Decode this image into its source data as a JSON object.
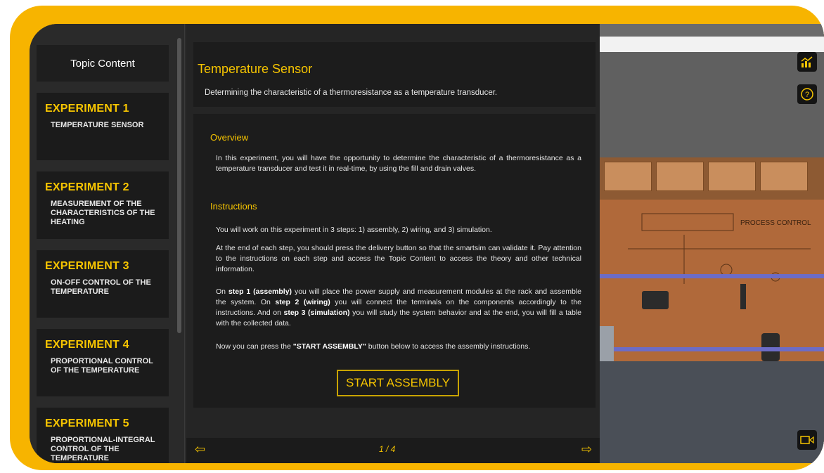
{
  "sidebar": {
    "topic_button": "Topic Content",
    "experiments": [
      {
        "title": "EXPERIMENT 1",
        "subtitle": "TEMPERATURE SENSOR"
      },
      {
        "title": "EXPERIMENT 2",
        "subtitle": "MEASUREMENT OF THE CHARACTERISTICS OF THE HEATING"
      },
      {
        "title": "EXPERIMENT 3",
        "subtitle": "ON-OFF CONTROL OF THE TEMPERATURE"
      },
      {
        "title": "EXPERIMENT 4",
        "subtitle": "PROPORTIONAL CONTROL OF THE TEMPERATURE"
      },
      {
        "title": "EXPERIMENT 5",
        "subtitle": "PROPORTIONAL-INTEGRAL CONTROL OF THE TEMPERATURE"
      }
    ]
  },
  "main": {
    "title": "Temperature Sensor",
    "description": "Determining the characteristic of a thermoresistance as a temperature transducer.",
    "overview_title": "Overview",
    "overview_text": "In this experiment, you will have the opportunity to determine the characteristic of a thermoresistance as a temperature transducer and test it in real-time, by using the fill and drain valves.",
    "instructions_title": "Instructions",
    "instr_p1": "You will work on this experiment in 3 steps: 1) assembly, 2) wiring, and 3) simulation.",
    "instr_p2": "At the end of each step, you should press the delivery button so that the smartsim can validate it. Pay attention to the instructions on each step and access the Topic Content to access the theory and other technical information.",
    "instr_p3": {
      "a": "On ",
      "b": "step 1 (assembly)",
      "c": " you will place the power supply and measurement modules at the rack and assemble the system. On ",
      "d": "step 2 (wiring)",
      "e": " you will connect the terminals on the components accordingly to the instructions. And on ",
      "f": "step 3 (simulation)",
      "g": " you will study the system behavior and at the end, you will fill a table with the collected data."
    },
    "instr_p4": {
      "a": "Now you can press the ",
      "b": "\"START ASSEMBLY\"",
      "c": " button below to access the assembly instructions."
    },
    "start_button": "START ASSEMBLY",
    "pager": "1 / 4"
  },
  "view": {
    "icons": [
      "chart-icon",
      "help-icon",
      "camera-icon"
    ],
    "panel_text": "PROCESS CONTROL"
  }
}
